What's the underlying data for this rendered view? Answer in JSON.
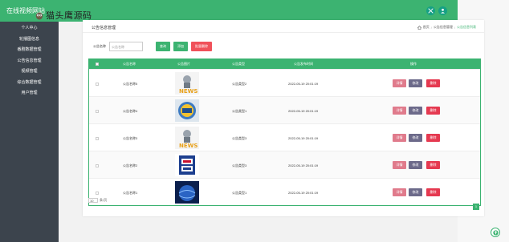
{
  "app": {
    "title": "在线视频网站",
    "watermark": "猫头鹰源码"
  },
  "sidebar": {
    "items": [
      {
        "label": "个人中心"
      },
      {
        "label": "轮播图信息"
      },
      {
        "label": "番剧数据管理"
      },
      {
        "label": "公告信息管理"
      },
      {
        "label": "视频管理"
      },
      {
        "label": "综合数据管理"
      },
      {
        "label": "用户管理"
      }
    ]
  },
  "panel": {
    "title": "公告信息管理",
    "breadcrumb": [
      "首页",
      "公告信息管理",
      "公告信息列表"
    ]
  },
  "search": {
    "label": "公告名称",
    "placeholder": "公告名称",
    "query_label": "查询",
    "add_label": "添加",
    "batch_delete_label": "批量删除"
  },
  "table": {
    "columns": [
      "公告名称",
      "公告图片",
      "公告类型",
      "公告发布时间",
      "操作"
    ],
    "rows": [
      {
        "name": "公告名称5",
        "image": "news-mascot",
        "type": "公告类型2",
        "time": "2022-05-19 20:01:19"
      },
      {
        "name": "公告名称4",
        "image": "news-badge",
        "type": "公告类型1",
        "time": "2022-05-19 20:01:19"
      },
      {
        "name": "公告名称3",
        "image": "news-mascot",
        "type": "公告类型3",
        "time": "2022-05-19 20:01:19"
      },
      {
        "name": "公告名称2",
        "image": "cctv-news-logo",
        "type": "公告类型3",
        "time": "2022-05-19 20:01:19"
      },
      {
        "name": "公告名称1",
        "image": "news-globe",
        "type": "公告类型1",
        "time": "2022-05-19 20:01:19"
      }
    ],
    "actions": {
      "detail": "详情",
      "edit": "修改",
      "delete": "删除"
    }
  },
  "pagination": {
    "page_size": "10",
    "page_size_suffix": "条/页",
    "current_page": "1"
  },
  "colors": {
    "primary": "#3cb371",
    "sidebar": "#3c444d",
    "danger": "#e53950"
  }
}
